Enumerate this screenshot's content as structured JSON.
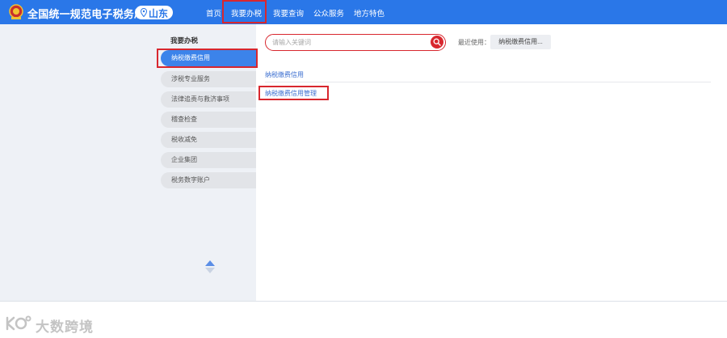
{
  "header": {
    "site_title": "全国统一规范电子税务局",
    "region": "山东",
    "nav": [
      {
        "label": "首页"
      },
      {
        "label": "我要办税",
        "active": true
      },
      {
        "label": "我要查询"
      },
      {
        "label": "公众服务"
      },
      {
        "label": "地方特色"
      }
    ],
    "logo_icon": "tax-emblem-icon",
    "region_icon": "location-pin-icon",
    "brand_color": "#2a77e8"
  },
  "sidebar": {
    "title": "我要办税",
    "items": [
      {
        "label": "纳税缴费信用",
        "active": true
      },
      {
        "label": "涉税专业服务"
      },
      {
        "label": "法律追责与救济事项"
      },
      {
        "label": "稽查检查"
      },
      {
        "label": "税收减免"
      },
      {
        "label": "企业集团"
      },
      {
        "label": "税务数字账户"
      }
    ],
    "scroll_icon": "scroll-up-down-icon"
  },
  "main": {
    "search": {
      "value": "",
      "placeholder": "请输入关键词",
      "button_icon": "search-icon"
    },
    "recent_label": "最近使用：",
    "recent_items": [
      "纳税缴费信用..."
    ],
    "section_title": "纳税缴费信用",
    "services": [
      "纳税缴费信用管理"
    ]
  },
  "watermark": {
    "text": "大数跨境",
    "logo_icon": "watermark-logo-icon"
  },
  "colors": {
    "highlight": "#d8272e",
    "active_item": "#3c83ea",
    "link": "#3c6fd0"
  }
}
